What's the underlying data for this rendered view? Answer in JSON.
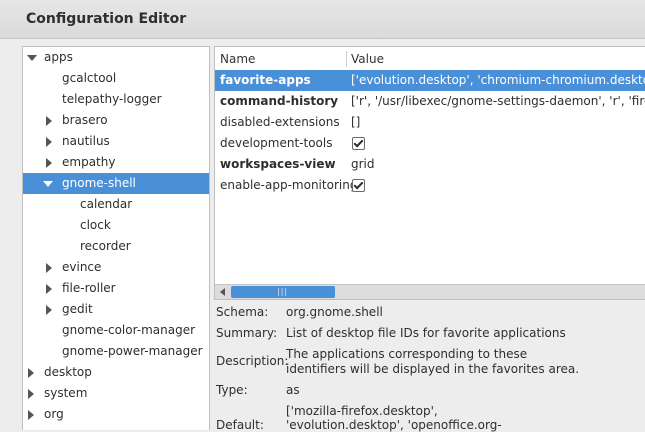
{
  "window": {
    "title": "Configuration Editor"
  },
  "tree": {
    "items": [
      {
        "label": "apps",
        "expander": "down"
      },
      {
        "label": "gcalctool",
        "expander": ""
      },
      {
        "label": "telepathy-logger",
        "expander": ""
      },
      {
        "label": "brasero",
        "expander": "right"
      },
      {
        "label": "nautilus",
        "expander": "right"
      },
      {
        "label": "empathy",
        "expander": "right"
      },
      {
        "label": "gnome-shell",
        "expander": "down",
        "selected": true
      },
      {
        "label": "calendar",
        "expander": ""
      },
      {
        "label": "clock",
        "expander": ""
      },
      {
        "label": "recorder",
        "expander": ""
      },
      {
        "label": "evince",
        "expander": "right"
      },
      {
        "label": "file-roller",
        "expander": "right"
      },
      {
        "label": "gedit",
        "expander": "right"
      },
      {
        "label": "gnome-color-manager",
        "expander": ""
      },
      {
        "label": "gnome-power-manager",
        "expander": ""
      },
      {
        "label": "desktop",
        "expander": "right"
      },
      {
        "label": "system",
        "expander": "right"
      },
      {
        "label": "org",
        "expander": "right"
      }
    ]
  },
  "keys": {
    "columns": {
      "name": "Name",
      "value": "Value"
    },
    "rows": [
      {
        "name": "favorite-apps",
        "value": "['evolution.desktop', 'chromium-chromium.desktop', 'n",
        "bold": true,
        "selected": true
      },
      {
        "name": "command-history",
        "value": "['r', '/usr/libexec/gnome-settings-daemon', 'r', 'firefox',",
        "bold": true
      },
      {
        "name": "disabled-extensions",
        "value": "[]",
        "bold": false
      },
      {
        "name": "development-tools",
        "value": "",
        "checkbox": true,
        "bold": false
      },
      {
        "name": "workspaces-view",
        "value": "grid",
        "bold": true
      },
      {
        "name": "enable-app-monitoring",
        "value": "",
        "checkbox": true,
        "bold": false
      }
    ]
  },
  "details": {
    "schema_label": "Schema:",
    "schema_value": "org.gnome.shell",
    "summary_label": "Summary:",
    "summary_value": "List of desktop file IDs for favorite applications",
    "description_label": "Description:",
    "description_line1": "The applications corresponding to these",
    "description_line2": "identifiers will be displayed in the favorites area.",
    "type_label": "Type:",
    "type_value": "as",
    "default_label": "Default:",
    "default_line1": "['mozilla-firefox.desktop',",
    "default_line2": "'evolution.desktop', 'openoffice.org-"
  }
}
